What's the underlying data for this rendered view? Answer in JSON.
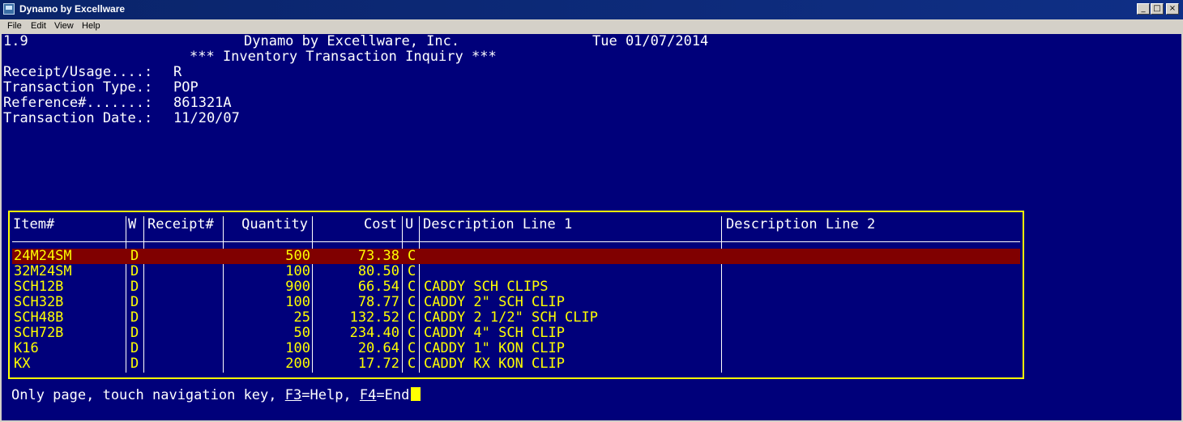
{
  "window": {
    "title": "Dynamo by Excellware"
  },
  "menu": [
    "File",
    "Edit",
    "View",
    "Help"
  ],
  "header": {
    "version": "1.9",
    "company": "Dynamo by Excellware, Inc.",
    "date": "Tue 01/07/2014",
    "screen_title": "*** Inventory Transaction Inquiry ***"
  },
  "fields": [
    {
      "label": "Receipt/Usage....:",
      "value": "R"
    },
    {
      "label": "Transaction Type.:",
      "value": "POP"
    },
    {
      "label": "Reference#.......:",
      "value": "861321A"
    },
    {
      "label": "Transaction Date.:",
      "value": "11/20/07"
    }
  ],
  "table": {
    "columns": [
      "Item#",
      "W",
      "Receipt#",
      "Quantity",
      "Cost",
      "U",
      "Description Line 1",
      "Description Line 2"
    ],
    "rows": [
      {
        "item": "24M24SM",
        "w": "D",
        "receipt": "",
        "quantity": "500",
        "cost": "73.38",
        "u": "C",
        "desc1": "",
        "desc2": "",
        "selected": true
      },
      {
        "item": "32M24SM",
        "w": "D",
        "receipt": "",
        "quantity": "100",
        "cost": "80.50",
        "u": "C",
        "desc1": "",
        "desc2": ""
      },
      {
        "item": "SCH12B",
        "w": "D",
        "receipt": "",
        "quantity": "900",
        "cost": "66.54",
        "u": "C",
        "desc1": "CADDY SCH CLIPS",
        "desc2": ""
      },
      {
        "item": "SCH32B",
        "w": "D",
        "receipt": "",
        "quantity": "100",
        "cost": "78.77",
        "u": "C",
        "desc1": "CADDY 2\" SCH CLIP",
        "desc2": ""
      },
      {
        "item": "SCH48B",
        "w": "D",
        "receipt": "",
        "quantity": "25",
        "cost": "132.52",
        "u": "C",
        "desc1": "CADDY 2 1/2\" SCH CLIP",
        "desc2": ""
      },
      {
        "item": "SCH72B",
        "w": "D",
        "receipt": "",
        "quantity": "50",
        "cost": "234.40",
        "u": "C",
        "desc1": "CADDY 4\" SCH CLIP",
        "desc2": ""
      },
      {
        "item": "K16",
        "w": "D",
        "receipt": "",
        "quantity": "100",
        "cost": "20.64",
        "u": "C",
        "desc1": "CADDY 1\" KON CLIP",
        "desc2": ""
      },
      {
        "item": "KX",
        "w": "D",
        "receipt": "",
        "quantity": "200",
        "cost": "17.72",
        "u": "C",
        "desc1": "CADDY KX KON CLIP",
        "desc2": ""
      }
    ]
  },
  "status": {
    "prefix": "Only page, touch navigation key, ",
    "f3_key": "F3",
    "f3_text": "=Help, ",
    "f4_key": "F4",
    "f4_text": "=End"
  },
  "colors": {
    "background": "#00007a",
    "highlight": "#ffff00",
    "selected_row": "#800000"
  }
}
